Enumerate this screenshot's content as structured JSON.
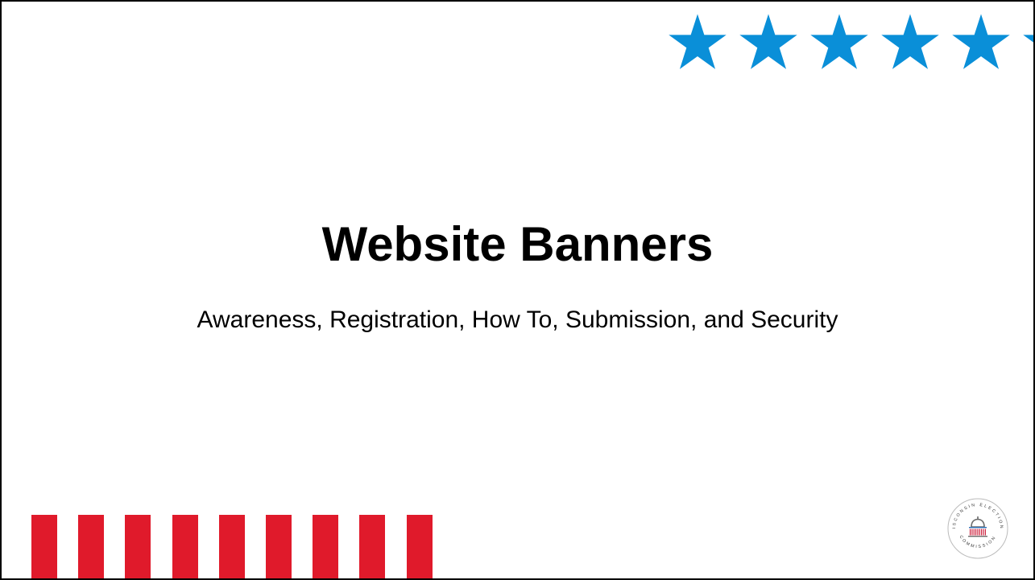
{
  "slide": {
    "title": "Website Banners",
    "subtitle": "Awareness, Registration, How To, Submission, and Security"
  },
  "decor": {
    "star_count": 6,
    "star_color": "#0a8fd8",
    "stripe_count": 9,
    "stripe_color": "#e01a2b"
  },
  "seal": {
    "text_top": "WISCONSIN ELECTIONS",
    "text_bottom": "COMMISSION",
    "icon": "capitol-dome-icon",
    "dome_color": "#6b6b6b",
    "column_color": "#c8102e",
    "dot_color": "#2a6fb5"
  }
}
